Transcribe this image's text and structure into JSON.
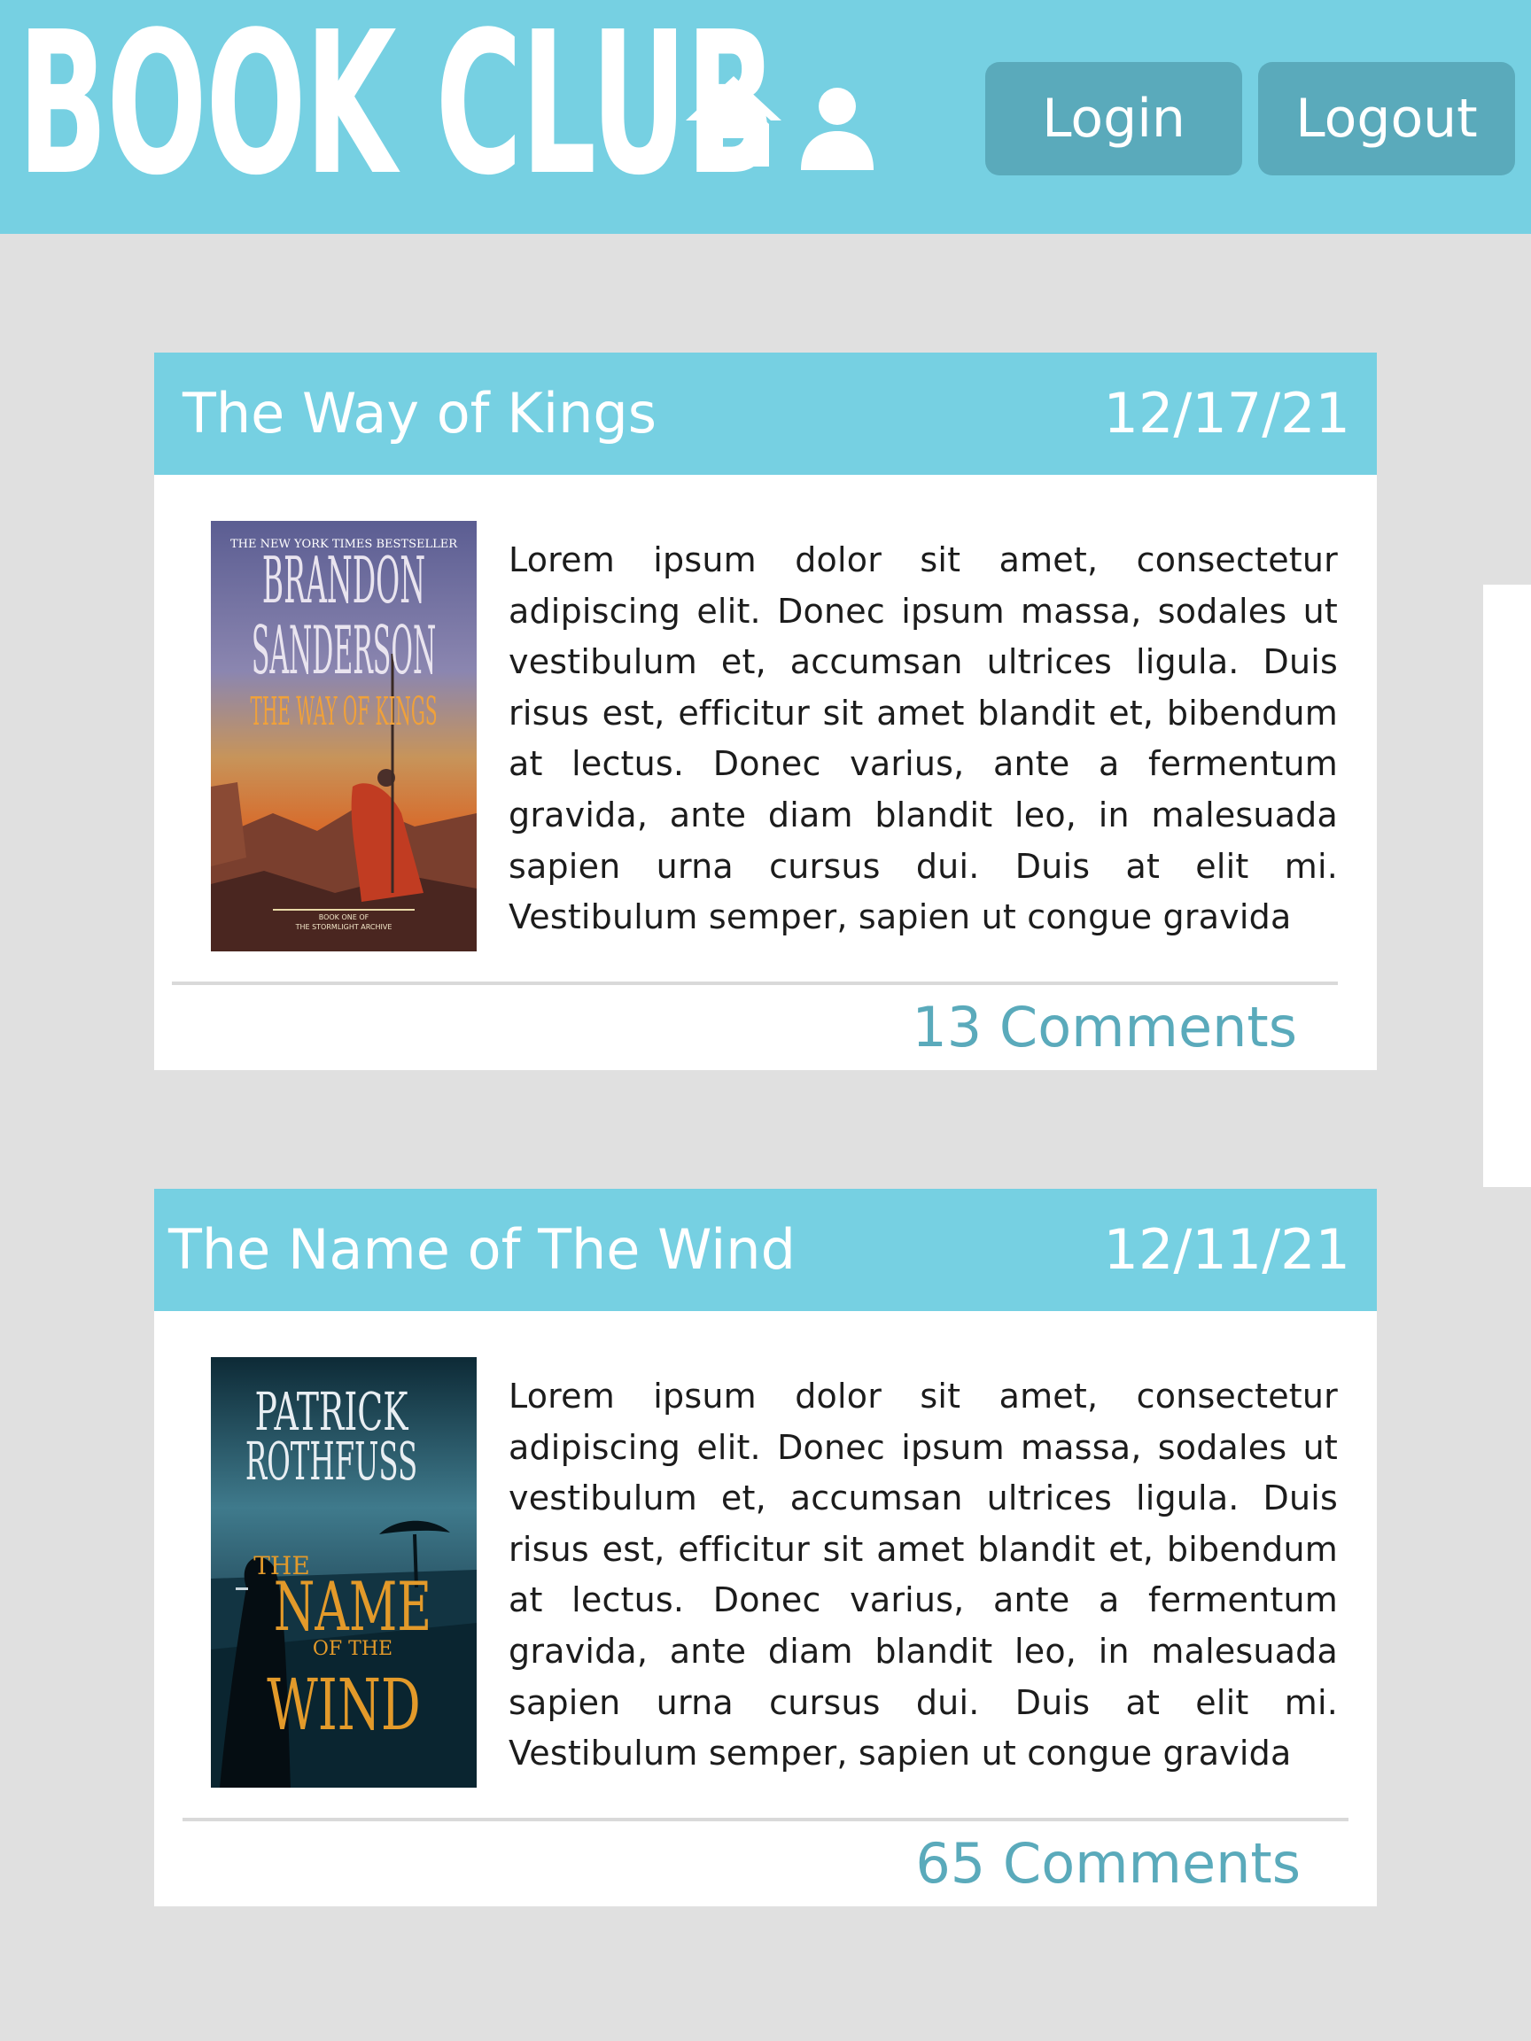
{
  "header": {
    "brand": "BOOK CLUB",
    "home_icon": "home-icon",
    "user_icon": "user-icon",
    "login_label": "Login",
    "logout_label": "Logout"
  },
  "colors": {
    "accent": "#76d0e2",
    "button": "#5aaabb",
    "background": "#e0e0e0",
    "card": "#ffffff",
    "comments_text": "#5aaabb"
  },
  "posts": [
    {
      "title": "The Way of Kings",
      "date": "12/17/21",
      "cover": {
        "banner": "THE NEW YORK TIMES BESTSELLER",
        "author_first": "BRANDON",
        "author_last": "SANDERSON",
        "book_title": "THE WAY OF KINGS",
        "series_line1": "BOOK ONE OF",
        "series_line2": "THE STORMLIGHT ARCHIVE"
      },
      "body": "Lorem ipsum dolor sit amet, consectetur adipiscing elit. Donec ipsum massa, sodales ut vestibulum et, accumsan ultrices ligula. Duis risus est, efficitur sit amet blandit et, bibendum at lectus. Donec varius, ante a fermentum gravida, ante diam blandit leo, in malesuada sapien urna cursus dui. Duis at elit mi. Vestibulum semper, sapien ut congue gravida",
      "comments": "13 Comments"
    },
    {
      "title": "The Name of The Wind",
      "date": "12/11/21",
      "cover": {
        "author_first": "PATRICK",
        "author_last": "ROTHFUSS",
        "title_the": "THE",
        "title_name": "NAME",
        "title_ofthe": "OF THE",
        "title_wind": "WIND"
      },
      "body": "Lorem ipsum dolor sit amet, consectetur adipiscing elit. Donec ipsum massa, sodales ut vestibulum et, accumsan ultrices ligula. Duis risus est, efficitur sit amet blandit et, bibendum at lectus. Donec varius, ante a fermentum gravida, ante diam blandit leo, in malesuada sapien urna cursus dui. Duis at elit mi. Vestibulum semper, sapien ut congue gravida",
      "comments": "65 Comments"
    }
  ]
}
